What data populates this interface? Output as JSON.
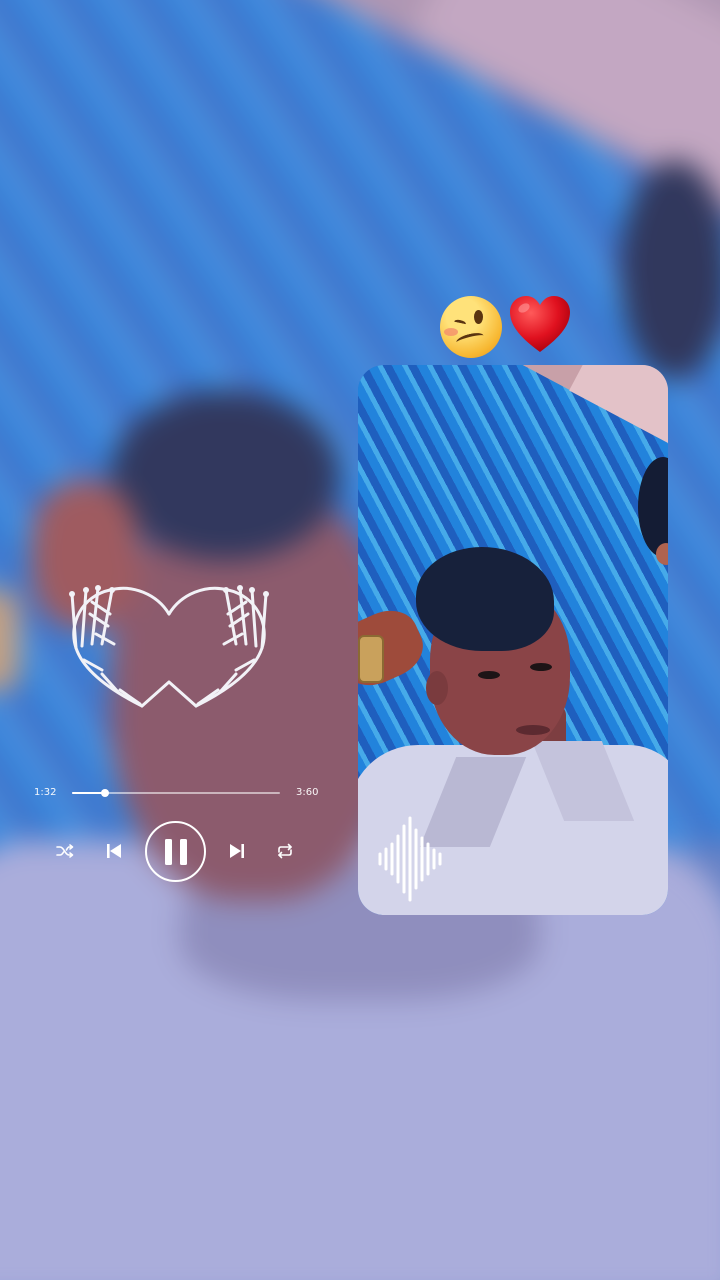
{
  "player": {
    "elapsed": "1:32",
    "total": "3:60",
    "progress": 0.16,
    "state": "playing"
  },
  "icons": {
    "shuffle": "shuffle-icon",
    "previous": "skip-previous-icon",
    "play_pause": "pause-icon",
    "next": "skip-next-icon",
    "repeat": "repeat-icon"
  },
  "decorations": {
    "emojis": [
      "woozy-face",
      "red-heart"
    ],
    "sticker": "skeleton-hands-heart",
    "waveform": "sound-wave"
  },
  "colors": {
    "controls": "#ffffff",
    "heart": "#e0111f",
    "backdrop_tint": "#8c8cdc"
  }
}
